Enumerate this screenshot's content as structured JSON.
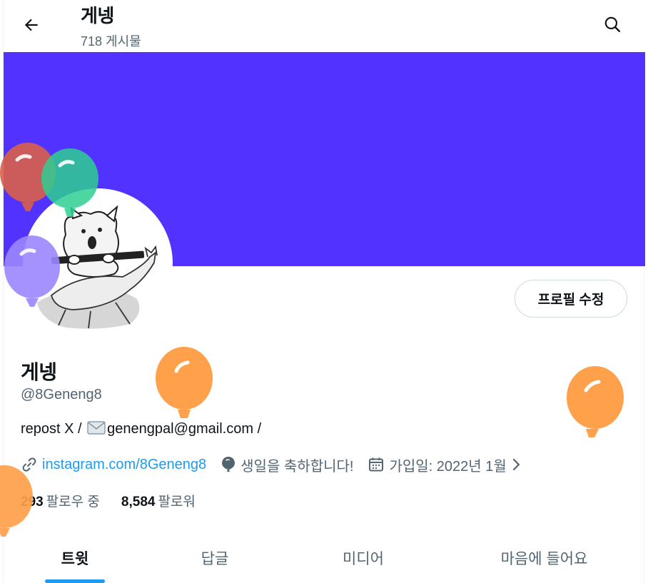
{
  "header": {
    "title": "게넹",
    "post_count": "718",
    "post_label": "게시물"
  },
  "profile": {
    "edit_button": "프로필 수정",
    "display_name": "게넹",
    "handle": "@8Geneng8",
    "bio_prefix": "repost X / ",
    "bio_email": "genengpal@gmail.com /",
    "link": "instagram.com/8Geneng8",
    "birthday": "생일을 축하합니다!",
    "joined": "가입일: 2022년 1월"
  },
  "follow": {
    "following_count": "293",
    "following_label": "팔로우 중",
    "followers_count": "8,584",
    "followers_label": "팔로워"
  },
  "tabs": [
    {
      "label": "트윗"
    },
    {
      "label": "답글"
    },
    {
      "label": "미디어"
    },
    {
      "label": "마음에 들어요"
    }
  ],
  "colors": {
    "banner": "#5132ff",
    "accent": "#1d9bf0",
    "balloon_red": "#d95f4a",
    "balloon_green": "#2ecf91",
    "balloon_purple": "#9b86ff",
    "balloon_orange": "#ffa04a"
  },
  "icons": [
    "back-arrow-icon",
    "search-icon",
    "link-icon",
    "balloon-icon",
    "calendar-icon",
    "chevron-right-icon",
    "mail-icon"
  ]
}
